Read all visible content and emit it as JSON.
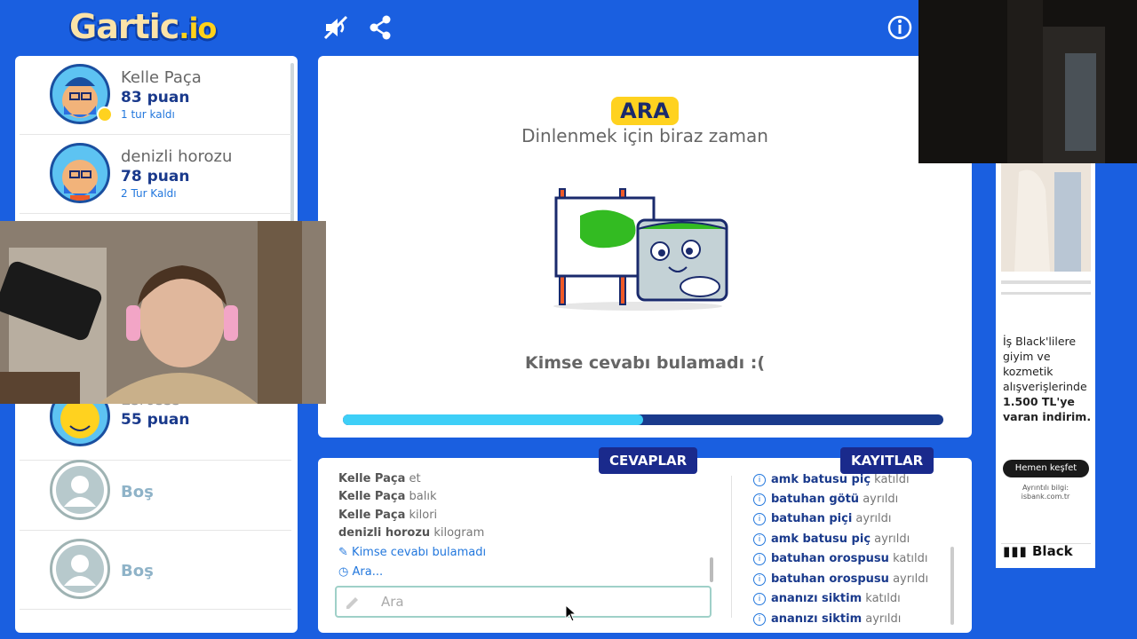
{
  "app": {
    "logo_text": "Gartic",
    "logo_suffix": ".io"
  },
  "players": [
    {
      "name": "Kelle Paça",
      "score": "83 puan",
      "turns": "1 tur kaldı"
    },
    {
      "name": "denizli horozu",
      "score": "78 puan",
      "turns": "2 Tur Kaldı"
    },
    {
      "name": "Esrosss",
      "score": "55 puan",
      "turns": ""
    },
    {
      "name": "Boş",
      "score": "",
      "turns": ""
    },
    {
      "name": "Boş",
      "score": "",
      "turns": ""
    }
  ],
  "main": {
    "badge": "ARA",
    "subtitle": "Dinlenmek için biraz zaman",
    "message": "Kimse cevabı bulamadı :(",
    "progress": 0.5
  },
  "tabs": {
    "answers": "CEVAPLAR",
    "logs": "KAYITLAR"
  },
  "answers": [
    {
      "user": "Kelle Paça",
      "text": "et"
    },
    {
      "user": "Kelle Paça",
      "text": "balık"
    },
    {
      "user": "Kelle Paça",
      "text": "kilori"
    },
    {
      "user": "denizli horozu",
      "text": "kilogram"
    }
  ],
  "answer_notices": {
    "no_answer": "Kimse cevabı bulamadı",
    "pause": "Ara..."
  },
  "answer_input": {
    "placeholder": "Ara"
  },
  "logs": [
    {
      "user": "amk batusu piç",
      "action": "katıldı"
    },
    {
      "user": "batuhan götü",
      "action": "ayrıldı"
    },
    {
      "user": "batuhan piçi",
      "action": "ayrıldı"
    },
    {
      "user": "amk batusu piç",
      "action": "ayrıldı"
    },
    {
      "user": "batuhan orospusu",
      "action": "katıldı"
    },
    {
      "user": "batuhan orospusu",
      "action": "ayrıldı"
    },
    {
      "user": "ananızı siktim",
      "action": "katıldı"
    },
    {
      "user": "ananızı siktim",
      "action": "ayrıldı"
    }
  ],
  "ad": {
    "text_1": "İş Black'lilere giyim ve kozmetik alışverişlerinde",
    "text_2": "1.500 TL'ye varan indirim.",
    "button": "Hemen keşfet",
    "small_1": "Ayrıntılı bilgi:",
    "small_2": "isbank.com.tr",
    "brand": "Black"
  },
  "colors": {
    "background": "#1a5fe0",
    "accent": "#ffd21f",
    "tab": "#1a2a8c",
    "progress": "#3ecff7"
  }
}
